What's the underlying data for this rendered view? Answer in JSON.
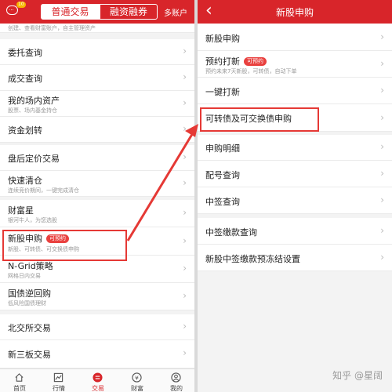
{
  "colors": {
    "brand_red": "#d8252a",
    "highlight": "#e53935"
  },
  "left": {
    "notification_badge": "10",
    "tabs": {
      "normal": "普通交易",
      "margin": "融资融券",
      "multi": "多账户"
    },
    "partial_subtitle": "创建、查看财富账户，自主管理资产",
    "items": [
      {
        "label": "委托查询"
      },
      {
        "label": "成交查询"
      },
      {
        "label": "我的场内资产",
        "sub": "股票、场内基金持仓"
      },
      {
        "label": "资金划转"
      },
      {
        "label": "盘后定价交易"
      },
      {
        "label": "快速清仓",
        "sub": "连续竞价期间，一键完成清仓"
      },
      {
        "label": "财富星",
        "sub": "银河牛人，为您选股"
      },
      {
        "label": "新股申购",
        "sub": "新股、可转债、可交换债申购",
        "badge": "可预约"
      },
      {
        "label": "N-Grid策略",
        "sub": "网格日内交易"
      },
      {
        "label": "国债逆回购",
        "sub": "低风险国债理财"
      },
      {
        "label": "北交所交易"
      },
      {
        "label": "新三板交易"
      }
    ],
    "tabbar": [
      "首页",
      "行情",
      "交易",
      "财富",
      "我的"
    ]
  },
  "right": {
    "title": "新股申购",
    "items": [
      {
        "label": "新股申购"
      },
      {
        "label": "预约打新",
        "badge": "可预约",
        "sub": "预约未来7天新股，可转债，自动下单"
      },
      {
        "label": "一键打新"
      },
      {
        "label": "可转债及可交换债申购"
      },
      {
        "label": "申购明细"
      },
      {
        "label": "配号查询"
      },
      {
        "label": "中签查询"
      },
      {
        "label": "中签缴款查询"
      },
      {
        "label": "新股中签缴款预冻结设置"
      }
    ]
  },
  "watermark": "知乎 @星阔"
}
